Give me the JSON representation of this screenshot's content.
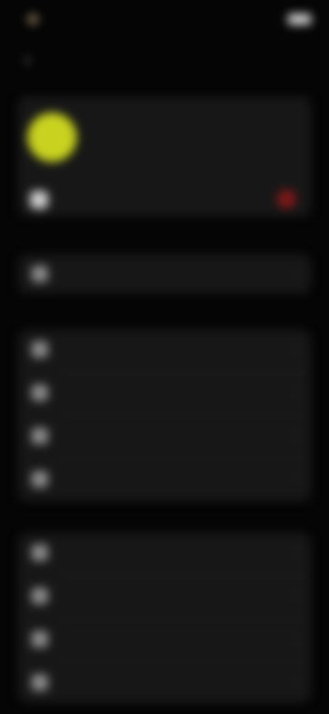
{
  "status_bar": {
    "time": "",
    "signal": ""
  },
  "header": {
    "title": ""
  },
  "profile": {
    "name": "",
    "subtitle": "",
    "row_label": ""
  },
  "single": {
    "label": ""
  },
  "group1": {
    "items": [
      {
        "label": "",
        "icon": "settings-icon"
      },
      {
        "label": "",
        "icon": "list-icon"
      },
      {
        "label": "",
        "icon": "globe-icon"
      },
      {
        "label": "",
        "icon": "folder-icon"
      }
    ]
  },
  "group2": {
    "items": [
      {
        "label": "",
        "icon": "info-icon"
      },
      {
        "label": "",
        "icon": "help-icon"
      },
      {
        "label": "",
        "icon": "chat-icon"
      },
      {
        "label": "",
        "icon": "star-icon"
      }
    ]
  },
  "colors": {
    "background": "#050505",
    "card": "#171717",
    "avatar": "#c8d21f",
    "badge": "#7e1818"
  }
}
